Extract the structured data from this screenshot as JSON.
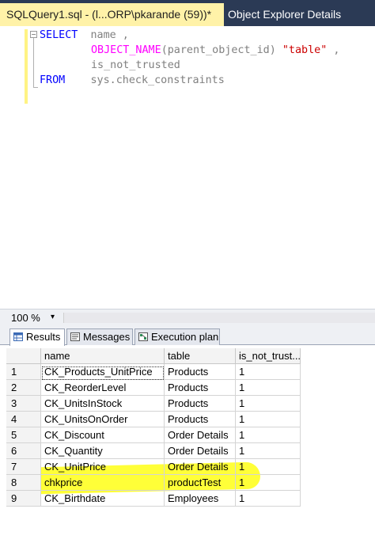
{
  "tabs": {
    "active_label": "SQLQuery1.sql - (l...ORP\\pkarande (59))*",
    "inactive_label": "Object Explorer Details"
  },
  "editor": {
    "lines": [
      {
        "kw": "SELECT",
        "rest": "  name ,"
      },
      {
        "fn": "OBJECT_NAME",
        "open": "(",
        "arg": "parent_object_id",
        "close": ")",
        "str": " \"table\"",
        "tail": " ,"
      },
      {
        "id": "is_not_trusted"
      },
      {
        "kw": "FROM",
        "rest": "    sys.check_constraints"
      }
    ]
  },
  "zoom": {
    "level": "100 %",
    "dropdown": "▾"
  },
  "results_tabs": [
    {
      "label": "Results",
      "icon": "grid-icon",
      "selected": true
    },
    {
      "label": "Messages",
      "icon": "messages-icon",
      "selected": false
    },
    {
      "label": "Execution plan",
      "icon": "execution-plan-icon",
      "selected": false
    }
  ],
  "grid": {
    "columns": [
      "",
      "name",
      "table",
      "is_not_trust..."
    ],
    "rows": [
      [
        "1",
        "CK_Products_UnitPrice",
        "Products",
        "1"
      ],
      [
        "2",
        "CK_ReorderLevel",
        "Products",
        "1"
      ],
      [
        "3",
        "CK_UnitsInStock",
        "Products",
        "1"
      ],
      [
        "4",
        "CK_UnitsOnOrder",
        "Products",
        "1"
      ],
      [
        "5",
        "CK_Discount",
        "Order Details",
        "1"
      ],
      [
        "6",
        "CK_Quantity",
        "Order Details",
        "1"
      ],
      [
        "7",
        "CK_UnitPrice",
        "Order Details",
        "1"
      ],
      [
        "8",
        "chkprice",
        "productTest",
        "1"
      ],
      [
        "9",
        "CK_Birthdate",
        "Employees",
        "1"
      ]
    ],
    "highlighted_row": 8
  },
  "colors": {
    "tab_strip": "#2b3a55",
    "active_tab": "#fff2a8",
    "keyword": "#0000ff",
    "function": "#ff00ff",
    "string": "#cc0000",
    "highlight": "#ffff00"
  }
}
